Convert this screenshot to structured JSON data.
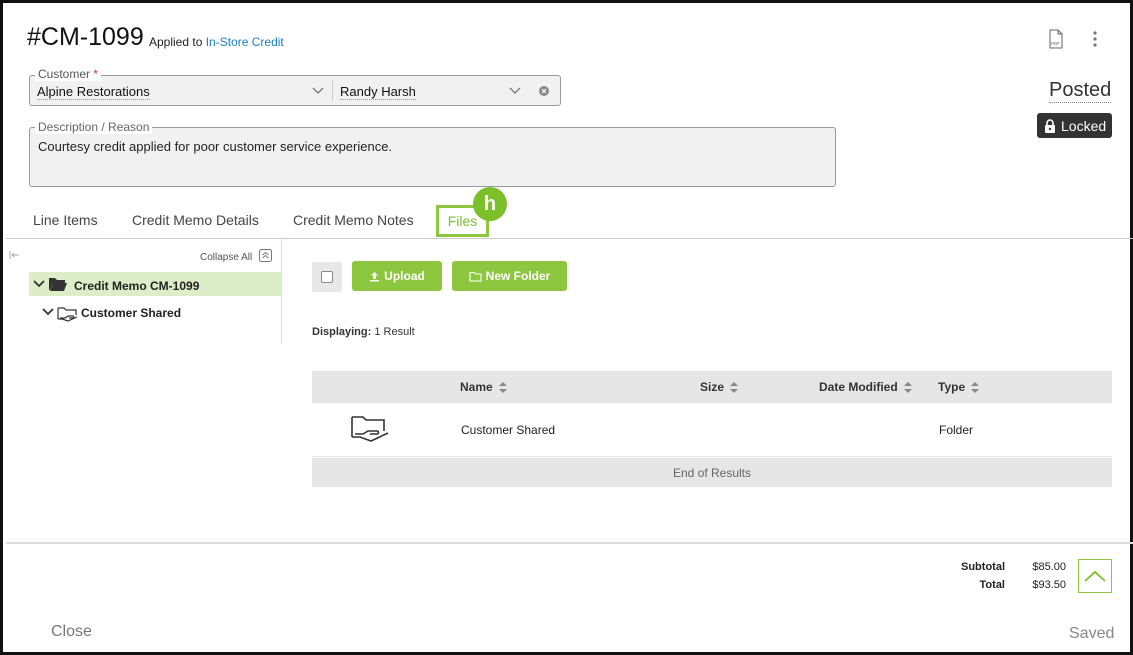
{
  "header": {
    "doc_number": "#CM-1099",
    "applied_prefix": "Applied to",
    "applied_link": "In-Store Credit",
    "pdf_icon": "pdf-icon",
    "more_icon": "more-vertical-icon"
  },
  "customer": {
    "label": "Customer",
    "required_mark": "*",
    "company": "Alpine Restorations",
    "contact": "Randy Harsh"
  },
  "status": {
    "state": "Posted",
    "locked_label": "Locked"
  },
  "description": {
    "label": "Description / Reason",
    "value": "Courtesy credit applied for poor customer service experience."
  },
  "tabs": [
    {
      "label": "Line Items"
    },
    {
      "label": "Credit Memo Details"
    },
    {
      "label": "Credit Memo Notes"
    },
    {
      "label": "Files",
      "active": true
    }
  ],
  "hint_badge": "h",
  "tree": {
    "collapse_all": "Collapse All",
    "root_label": "Credit Memo CM-1099",
    "child_label": "Customer Shared"
  },
  "toolbar": {
    "upload_label": "Upload",
    "new_folder_label": "New Folder"
  },
  "results": {
    "displaying_label": "Displaying:",
    "displaying_value": "1 Result"
  },
  "table": {
    "columns": [
      "Name",
      "Size",
      "Date Modified",
      "Type"
    ],
    "rows": [
      {
        "name": "Customer Shared",
        "size": "",
        "date_modified": "",
        "type": "Folder"
      }
    ],
    "end_label": "End of Results"
  },
  "totals": {
    "subtotal_label": "Subtotal",
    "subtotal_value": "$85.00",
    "total_label": "Total",
    "total_value": "$93.50"
  },
  "footer": {
    "close_label": "Close",
    "saved_label": "Saved"
  },
  "colors": {
    "accent_green": "#8dc63f",
    "link_blue": "#1a7fc1",
    "selected_row": "#dcedc8"
  }
}
